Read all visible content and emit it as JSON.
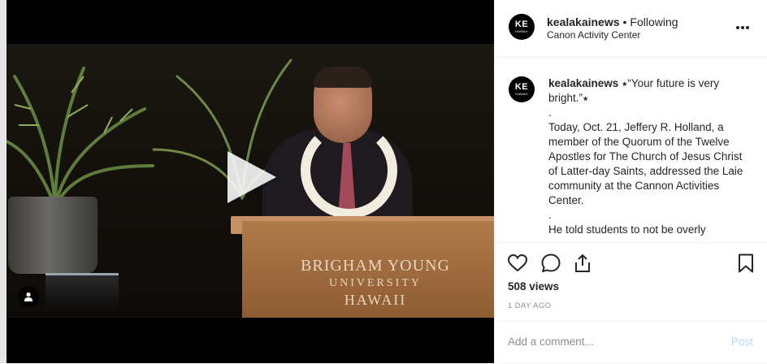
{
  "video": {
    "podium_text": [
      "BRIGHAM YOUNG",
      "UNIVERSITY",
      "HAWAII"
    ]
  },
  "post": {
    "avatar_text": "KE",
    "avatar_subtext": "HAWAII",
    "username": "kealakainews",
    "separator": "•",
    "follow_status": "Following",
    "location": "Canon Activity Center",
    "caption_username": "kealakainews",
    "caption_lines": [
      "⭑“Your future is very bright.”⭑",
      ".",
      "Today, Oct. 21, Jeffery R. Holland, a member of the Quorum of the Twelve Apostles for The Church of Jesus Christ of Latter-day Saints, addressed the Laie community at the Cannon Activities Center.",
      ".",
      "He told students to not be overly"
    ],
    "views": "508 views",
    "timestamp": "1 DAY AGO",
    "comment_placeholder": "Add a comment...",
    "post_label": "Post"
  },
  "colors": {
    "post_button_disabled": "#b3dbff",
    "muted_text": "#8e8e8e",
    "primary_text": "#262626"
  },
  "icons": [
    "heart-icon",
    "comment-icon",
    "share-icon",
    "bookmark-icon",
    "more-options-icon",
    "play-icon",
    "user-tag-icon"
  ]
}
